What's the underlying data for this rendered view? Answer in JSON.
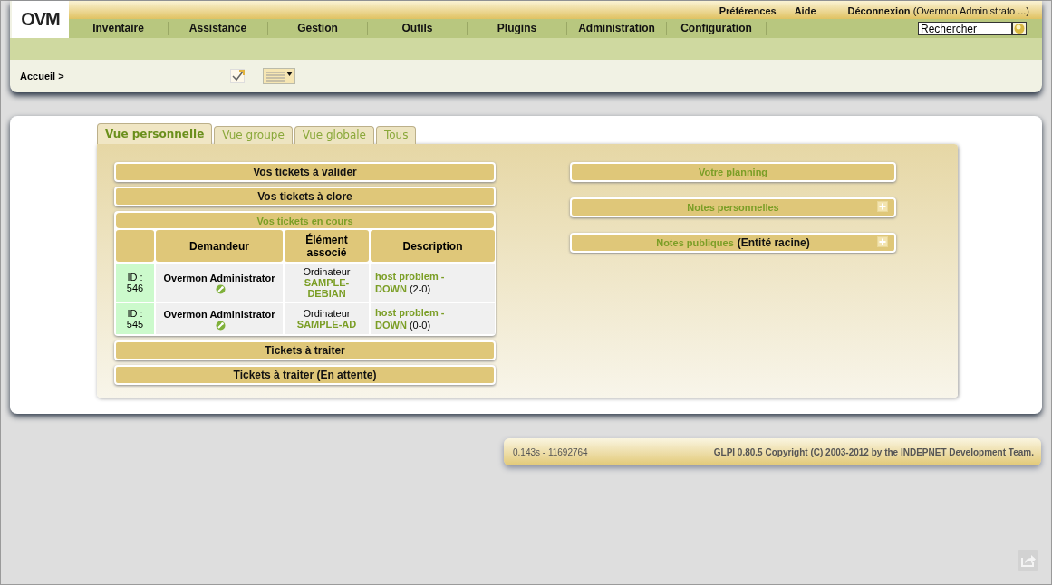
{
  "header": {
    "logo": "OVM",
    "top_links": [
      "Préférences",
      "Aide"
    ],
    "logout": {
      "label": "Déconnexion",
      "user": "(Overmon Administrato ...)"
    },
    "menu": [
      "Inventaire",
      "Assistance",
      "Gestion",
      "Outils",
      "Plugins",
      "Administration",
      "Configuration"
    ],
    "search": {
      "value": "Rechercher"
    },
    "breadcrumb": "Accueil >"
  },
  "tabs": [
    {
      "label": "Vue personnelle",
      "selected": true
    },
    {
      "label": "Vue groupe",
      "selected": false
    },
    {
      "label": "Vue globale",
      "selected": false
    },
    {
      "label": "Tous",
      "selected": false
    }
  ],
  "left_panels": [
    {
      "kind": "bar",
      "title": "Vos tickets à valider",
      "linked": false
    },
    {
      "kind": "bar",
      "title": "Vos tickets à clore",
      "linked": false
    },
    {
      "kind": "table",
      "title": "Vos tickets en cours",
      "linked": true,
      "columns": [
        "Demandeur",
        "Élément associé",
        "Description"
      ],
      "rows": [
        {
          "id": "ID : 546",
          "requester": "Overmon Administrator",
          "item_type": "Ordinateur",
          "item_name": "SAMPLE-DEBIAN",
          "description": "host problem - DOWN",
          "counts": "(2-0)"
        },
        {
          "id": "ID : 545",
          "requester": "Overmon Administrator",
          "item_type": "Ordinateur",
          "item_name": "SAMPLE-AD",
          "description": "host problem - DOWN",
          "counts": "(0-0)"
        }
      ]
    },
    {
      "kind": "bar",
      "title": "Tickets à traiter",
      "linked": false
    },
    {
      "kind": "bar",
      "title": "Tickets à traiter (En attente)",
      "linked": false
    }
  ],
  "right_panels": [
    {
      "kind": "planning",
      "title": "Votre planning",
      "linked": true
    },
    {
      "kind": "note",
      "title": "Notes personnelles",
      "linked": true
    },
    {
      "kind": "note",
      "title": "Notes publiques",
      "suffix": "(Entité racine)",
      "linked": true
    }
  ],
  "footer": {
    "timing": "0.143s - 11692764",
    "copyright": "GLPI 0.80.5 Copyright (C) 2003-2012 by the INDEPNET Development Team."
  }
}
